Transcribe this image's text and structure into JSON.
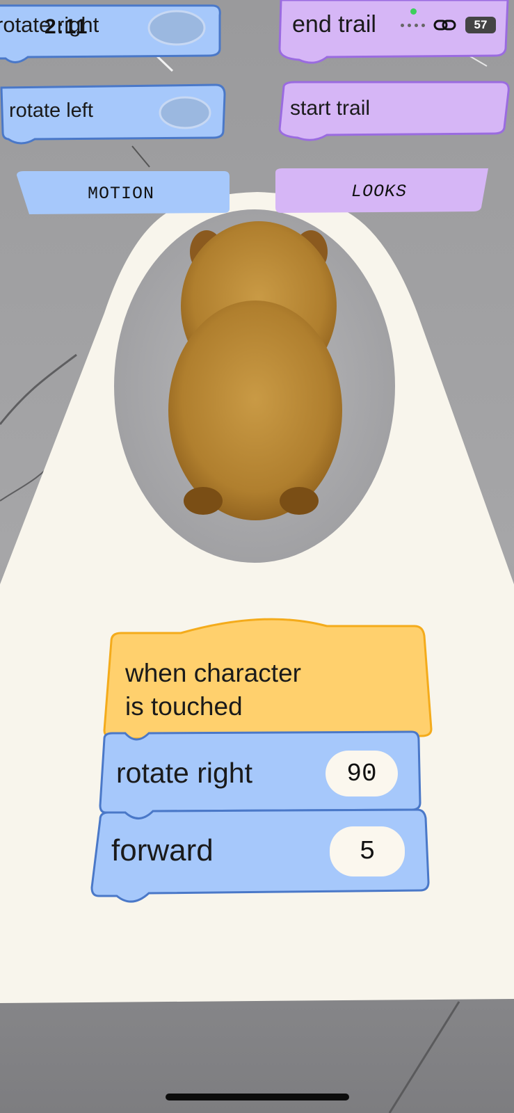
{
  "status": {
    "time": "2:11",
    "battery": "57"
  },
  "palette": {
    "motion": "#a6c8fb",
    "motion_border": "#4a78c8",
    "looks": "#d6b6f6",
    "looks_border": "#9a6be0",
    "event": "#ffd06d",
    "event_border": "#f4ab1b",
    "panel": "#f8f5ec",
    "cam_dot": "#3ccf5c"
  },
  "palette_blocks": {
    "motion": [
      {
        "label": "rotate right"
      },
      {
        "label": "rotate left"
      }
    ],
    "looks": [
      {
        "label": "end trail"
      },
      {
        "label": "start trail"
      }
    ]
  },
  "tabs": {
    "motion": "MOTION",
    "looks": "LOOKS"
  },
  "script": {
    "trigger": {
      "line1": "when character",
      "line2": "is touched"
    },
    "blocks": [
      {
        "label": "rotate right",
        "value": "90"
      },
      {
        "label": "forward",
        "value": "5"
      }
    ]
  },
  "icons": {
    "link": "link-icon"
  }
}
